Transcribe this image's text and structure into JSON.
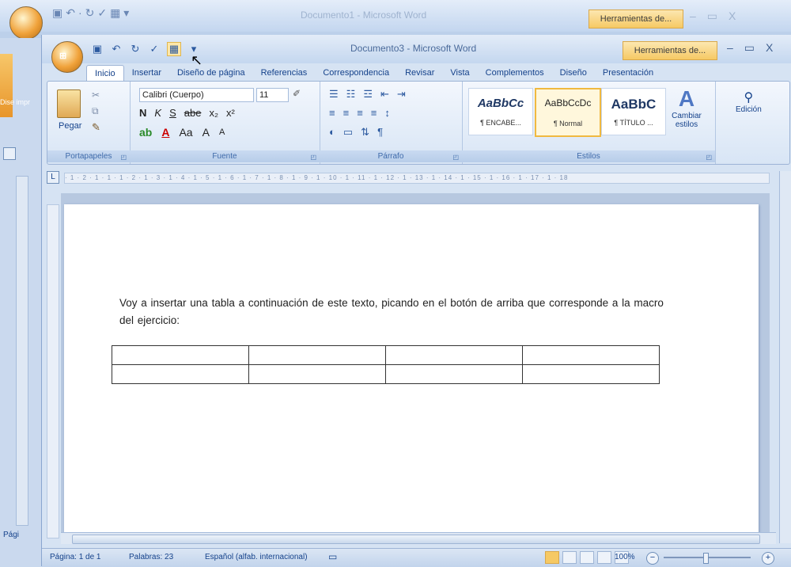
{
  "background_window": {
    "title": "Documento1 - Microsoft Word",
    "context_tab": "Herramientas de...",
    "left_label": "Dise impr",
    "status_label": "Pági"
  },
  "window": {
    "title": "Documento3 - Microsoft Word",
    "context_tab": "Herramientas de...",
    "controls": [
      "–",
      "▭",
      "X"
    ]
  },
  "tabs": [
    "Inicio",
    "Insertar",
    "Diseño de página",
    "Referencias",
    "Correspondencia",
    "Revisar",
    "Vista",
    "Complementos",
    "Diseño",
    "Presentación"
  ],
  "ribbon": {
    "clipboard": {
      "label": "Portapapeles",
      "paste": "Pegar"
    },
    "font": {
      "label": "Fuente",
      "name": "Calibri (Cuerpo)",
      "size": "11",
      "row2": [
        "N",
        "K",
        "S",
        "abe",
        "x₂",
        "x²"
      ],
      "row3": [
        "Aa",
        "A",
        "A"
      ]
    },
    "paragraph": {
      "label": "Párrafo"
    },
    "styles": {
      "label": "Estilos",
      "items": [
        {
          "preview": "AaBbCc",
          "name": "¶ ENCABE..."
        },
        {
          "preview": "AaBbCcDc",
          "name": "¶ Normal"
        },
        {
          "preview": "AaBbC",
          "name": "¶ TÍTULO ..."
        }
      ],
      "change_label": "Cambiar estilos"
    },
    "editing": {
      "label": "Edición"
    }
  },
  "ruler_text": "· 1 · 2 · 1 · 1 · 1 · 2 · 1 · 3 · 1 · 4 · 1 · 5 · 1 · 6 · 1 · 7 · 1 · 8 · 1 · 9 · 1 · 10 · 1 · 11 · 1 · 12 · 1 · 13 · 1 · 14 · 1 · 15 · 1 · 16 · 1 · 17 · 1 · 18",
  "document": {
    "paragraph": "Voy a insertar una tabla a continuación de este texto, picando en el botón de arriba que corresponde a la macro del ejercicio:",
    "table": {
      "rows": 2,
      "cols": 4
    }
  },
  "status": {
    "page": "Página: 1 de 1",
    "words": "Palabras: 23",
    "language": "Español (alfab. internacional)",
    "zoom": "100%"
  }
}
